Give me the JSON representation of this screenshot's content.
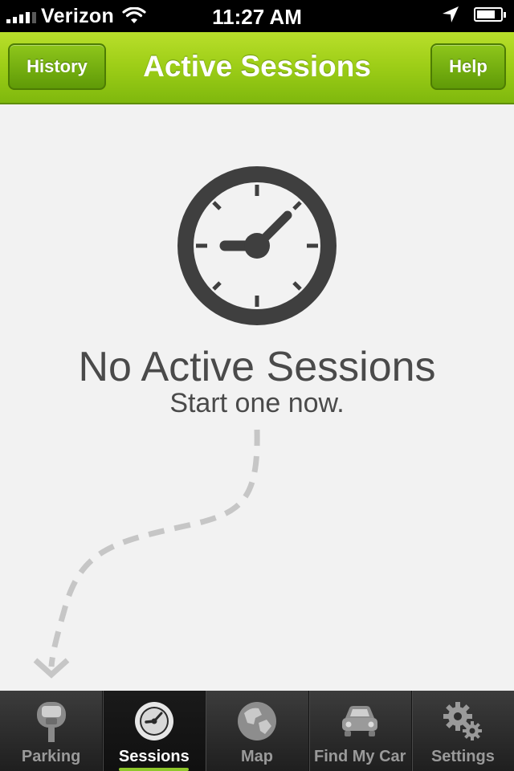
{
  "status_bar": {
    "carrier": "Verizon",
    "time": "11:27 AM",
    "signal_icon": "signal-icon",
    "wifi_icon": "wifi-icon",
    "location_icon": "location-arrow-icon",
    "battery_icon": "battery-icon",
    "battery_level": 0.8
  },
  "nav": {
    "title": "Active Sessions",
    "left_button": "History",
    "right_button": "Help",
    "accent_color": "#9fcf18"
  },
  "empty_state": {
    "icon": "clock-icon",
    "title": "No Active Sessions",
    "subtitle": "Start one now."
  },
  "tab_bar": {
    "tabs": [
      {
        "label": "Parking",
        "icon": "parking-meter-icon",
        "active": false
      },
      {
        "label": "Sessions",
        "icon": "clock-icon",
        "active": true
      },
      {
        "label": "Map",
        "icon": "globe-icon",
        "active": false
      },
      {
        "label": "Find My Car",
        "icon": "car-icon",
        "active": false
      },
      {
        "label": "Settings",
        "icon": "gears-icon",
        "active": false
      }
    ]
  }
}
